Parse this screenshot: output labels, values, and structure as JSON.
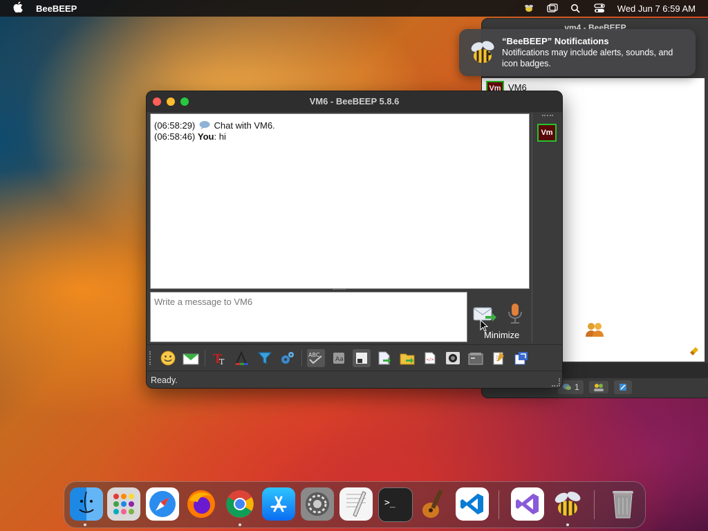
{
  "menubar": {
    "app_name": "BeeBEEP",
    "clock": "Wed Jun 7  6:59 AM",
    "icons": [
      "apple-icon",
      "beebeep-menubar-icon",
      "window-icon",
      "spotlight-icon",
      "control-center-icon"
    ]
  },
  "notification": {
    "title": "“BeeBEEP” Notifications",
    "body": "Notifications may include alerts, sounds, and icon badges."
  },
  "background_window": {
    "title": "vm4 - BeeBEEP",
    "user_badge": "Vm",
    "user_name": "VM6",
    "user_count": "1"
  },
  "window": {
    "title": "VM6 - BeeBEEP 5.8.6",
    "chat": [
      {
        "time": "(06:58:29)",
        "sender": "",
        "text": "Chat with VM6."
      },
      {
        "time": "(06:58:46)",
        "sender": "You",
        "text": ": hi"
      }
    ],
    "sidebar_user_badge": "Vm",
    "input_placeholder": "Write a message to VM6",
    "tooltip": "Minimize",
    "status": "Ready."
  },
  "toolbar_icons": [
    "emoticon-icon",
    "send-mail-icon",
    "text-font-icon",
    "text-color-icon",
    "filter-icon",
    "settings-gear-icon",
    "spellcheck-icon",
    "dictionary-icon",
    "compact-view-icon",
    "send-file-icon",
    "send-folder-icon",
    "html-source-icon",
    "screenshot-icon",
    "save-chat-icon",
    "clear-chat-icon",
    "detach-window-icon"
  ],
  "dock_apps": [
    "finder",
    "launchpad",
    "safari",
    "firefox",
    "chrome",
    "app-store",
    "system-settings",
    "textedit",
    "terminal",
    "garageband",
    "vscode",
    "visual-studio",
    "beebeep",
    "trash"
  ],
  "colors": {
    "accent_green": "#27c22a",
    "badge_red": "#5a0909"
  }
}
